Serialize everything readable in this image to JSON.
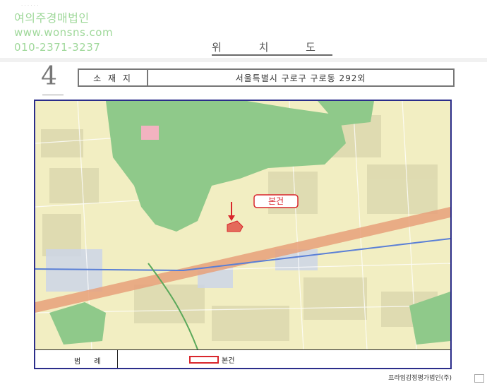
{
  "watermark": {
    "company": "여의주경매법인",
    "website": "www.wonsns.com",
    "phone": "010-2371-3237"
  },
  "header": {
    "title": "위 치 도",
    "page_number": "4"
  },
  "address_row": {
    "label": "소 재 지",
    "value": "서울특별시 구로구 구로동 292외"
  },
  "map": {
    "marker_label": "본건",
    "colors": {
      "frame": "#2b2d8a",
      "green_area": "#8fc98a",
      "marker": "#d9262c",
      "railway": "#e8a07a",
      "river": "#5a7fd6"
    }
  },
  "legend": {
    "label": "범 례",
    "item_label": "본건"
  },
  "footer": {
    "company": "프라임감정평가법인(주)"
  }
}
